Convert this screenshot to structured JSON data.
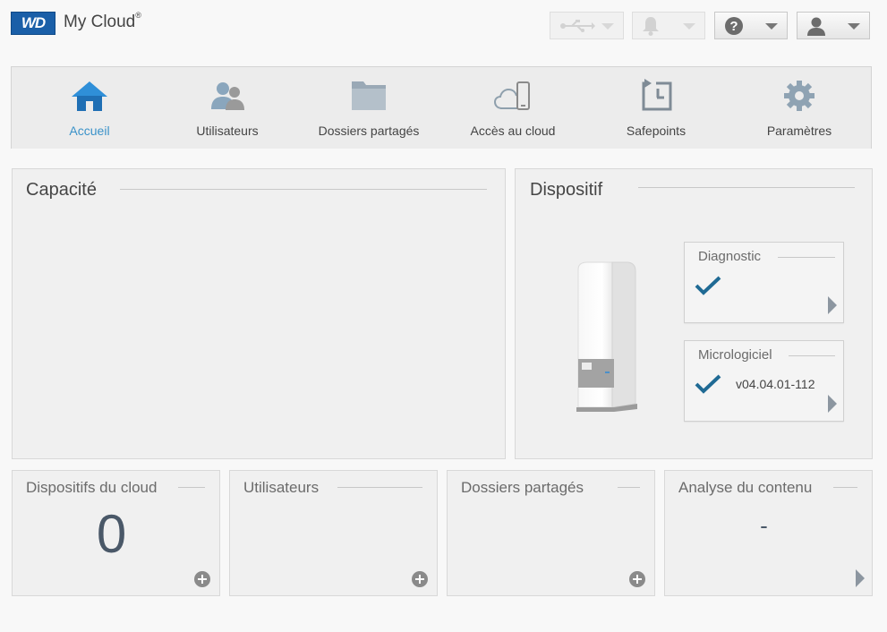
{
  "header": {
    "logo_text": "WD",
    "app_title": "My Cloud",
    "trademark": "®",
    "buttons": [
      {
        "icon": "usb-icon",
        "enabled": false
      },
      {
        "icon": "bell-icon",
        "enabled": false
      },
      {
        "icon": "help-icon",
        "enabled": true,
        "label": "?"
      },
      {
        "icon": "user-icon",
        "enabled": true
      }
    ]
  },
  "nav": {
    "items": [
      {
        "label": "Accueil",
        "icon": "home-icon",
        "active": true
      },
      {
        "label": "Utilisateurs",
        "icon": "users-icon",
        "active": false
      },
      {
        "label": "Dossiers partagés",
        "icon": "folder-icon",
        "active": false
      },
      {
        "label": "Accès au cloud",
        "icon": "cloud-device-icon",
        "active": false
      },
      {
        "label": "Safepoints",
        "icon": "safepoint-icon",
        "active": false
      },
      {
        "label": "Paramètres",
        "icon": "gear-icon",
        "active": false
      }
    ],
    "active_color": "#3a92c9"
  },
  "capacity": {
    "title": "Capacité"
  },
  "device": {
    "title": "Dispositif",
    "diagnostic": {
      "title": "Diagnostic"
    },
    "firmware": {
      "title": "Micrologiciel",
      "version": "v04.04.01-112"
    },
    "check_color": "#1f6a94"
  },
  "cards": [
    {
      "title": "Dispositifs du cloud",
      "value": "0"
    },
    {
      "title": "Utilisateurs",
      "value": ""
    },
    {
      "title": "Dossiers partagés",
      "value": ""
    },
    {
      "title": "Analyse du contenu",
      "value": "-"
    }
  ]
}
